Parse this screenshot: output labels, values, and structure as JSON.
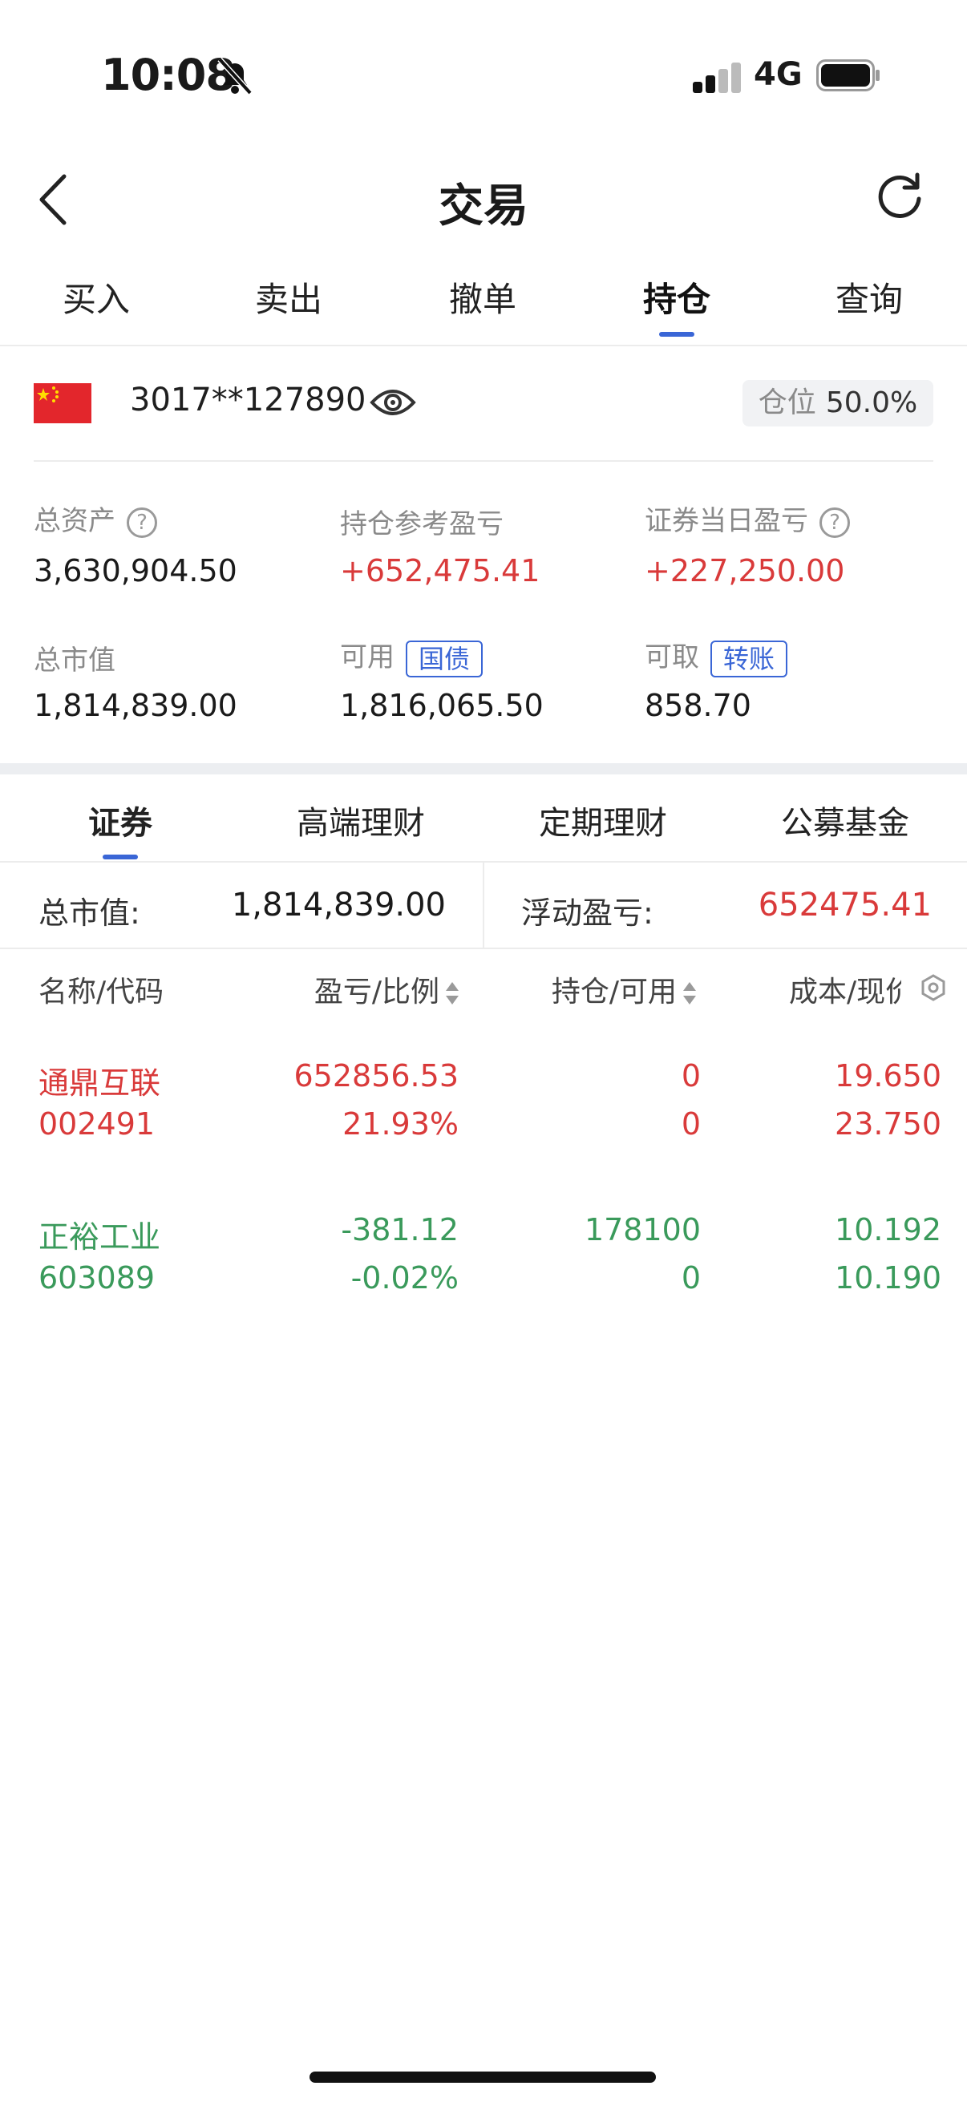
{
  "status": {
    "time": "10:08",
    "network": "4G"
  },
  "nav": {
    "title": "交易"
  },
  "top_tabs": [
    "买入",
    "卖出",
    "撤单",
    "持仓",
    "查询"
  ],
  "account": {
    "number": "3017**127890",
    "position_label": "仓位",
    "position_value": "50.0%"
  },
  "assets": {
    "total_assets_label": "总资产",
    "total_assets": "3,630,904.50",
    "holding_pnl_label": "持仓参考盈亏",
    "holding_pnl": "+652,475.41",
    "daily_pnl_label": "证券当日盈亏",
    "daily_pnl": "+227,250.00",
    "market_value_label": "总市值",
    "market_value": "1,814,839.00",
    "available_label": "可用",
    "available_tag": "国债",
    "available": "1,816,065.50",
    "withdrawable_label": "可取",
    "withdrawable_tag": "转账",
    "withdrawable": "858.70"
  },
  "sub_tabs": [
    "证券",
    "高端理财",
    "定期理财",
    "公募基金"
  ],
  "summary": {
    "market_value_label": "总市值:",
    "market_value": "1,814,839.00",
    "float_pnl_label": "浮动盈亏:",
    "float_pnl": "652475.41"
  },
  "table": {
    "headers": [
      "名称/代码",
      "盈亏/比例",
      "持仓/可用",
      "成本/现价"
    ],
    "rows": [
      {
        "name": "通鼎互联",
        "code": "002491",
        "pnl": "652856.53",
        "ratio": "21.93%",
        "holding": "0",
        "available": "0",
        "cost": "19.650",
        "price": "23.750",
        "color": "#d93a3a"
      },
      {
        "name": "正裕工业",
        "code": "603089",
        "pnl": "-381.12",
        "ratio": "-0.02%",
        "holding": "178100",
        "available": "0",
        "cost": "10.192",
        "price": "10.190",
        "color": "#3a9a5b"
      }
    ]
  },
  "colors": {
    "accent": "#3a66d6",
    "up": "#d93a3a",
    "down": "#3a9a5b"
  }
}
